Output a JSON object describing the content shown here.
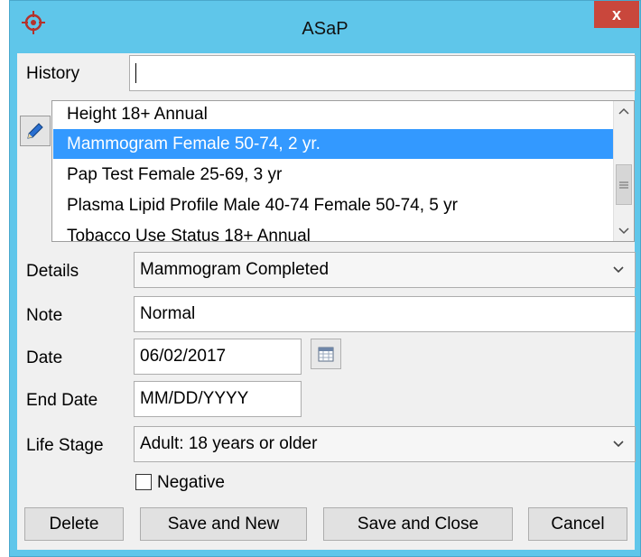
{
  "window": {
    "title": "ASaP",
    "close_label": "x"
  },
  "history": {
    "label": "History",
    "value": "",
    "items": [
      "Height 18+ Annual",
      "Mammogram Female 50-74, 2 yr.",
      "Pap Test Female 25-69, 3 yr",
      "Plasma Lipid Profile Male 40-74 Female 50-74, 5 yr",
      "Tobacco Use Status 18+ Annual"
    ],
    "selected_index": 1
  },
  "details": {
    "label": "Details",
    "value": "Mammogram Completed"
  },
  "note": {
    "label": "Note",
    "value": "Normal"
  },
  "date": {
    "label": "Date",
    "value": "06/02/2017"
  },
  "end_date": {
    "label": "End Date",
    "value": "MM/DD/YYYY"
  },
  "life_stage": {
    "label": "Life Stage",
    "value": "Adult: 18 years or older"
  },
  "negative": {
    "label": "Negative",
    "checked": false
  },
  "buttons": {
    "delete": "Delete",
    "save_new": "Save and New",
    "save_close": "Save and Close",
    "cancel": "Cancel"
  },
  "icons": {
    "app": "target-icon",
    "edit": "pencil-icon",
    "calendar": "calendar-icon",
    "scroll_up": "chevron-up-icon",
    "scroll_down": "chevron-down-icon",
    "dropdown": "chevron-down-icon"
  },
  "colors": {
    "titlebar": "#5fc6ea",
    "selection": "#3399ff",
    "close": "#c9473c"
  }
}
